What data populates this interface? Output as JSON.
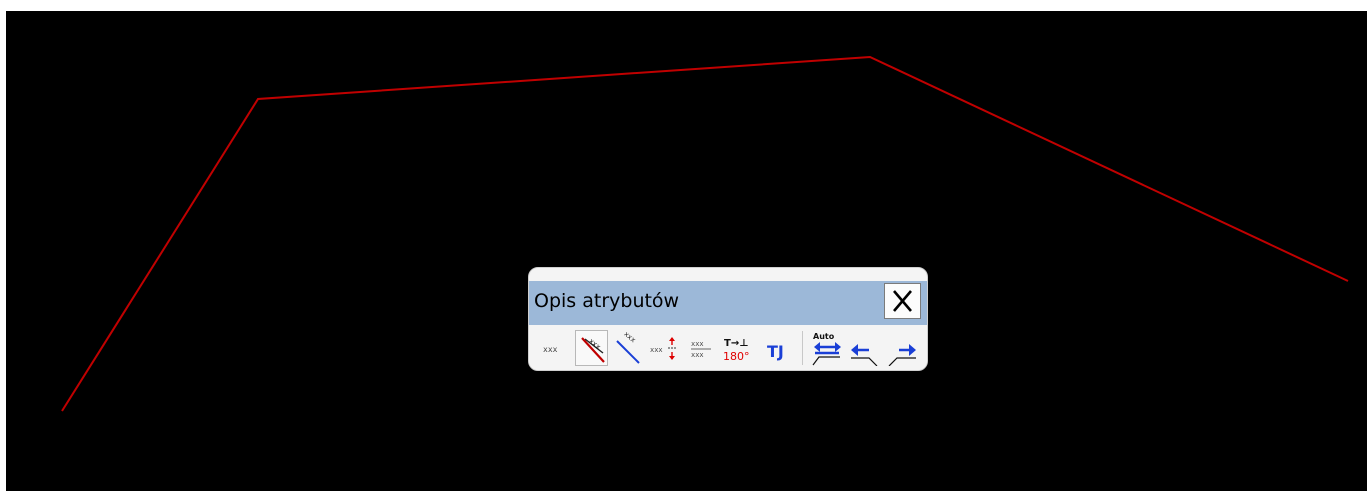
{
  "canvas": {
    "background": "#000000",
    "polyline_color": "#c00000"
  },
  "toolbar": {
    "title": "Opis atrybutów",
    "close_label": "X",
    "title_bar_color": "#9cb8d8",
    "tools": [
      {
        "name": "text-plain-tool",
        "icon": "xxx-text-icon",
        "pressed": false
      },
      {
        "name": "text-along-line-crossed-tool",
        "icon": "text-along-line-red-icon",
        "pressed": true
      },
      {
        "name": "text-along-line-tool",
        "icon": "text-along-line-blue-icon",
        "pressed": false
      },
      {
        "name": "text-offset-tool",
        "icon": "text-offset-red-arrows-icon",
        "pressed": false
      },
      {
        "name": "text-stacked-tool",
        "icon": "text-stacked-icon",
        "pressed": false
      },
      {
        "name": "text-rotate-180-tool",
        "icon": "rotate-180-icon",
        "pressed": false
      },
      {
        "name": "text-justify-tool",
        "icon": "tj-icon",
        "pressed": false
      },
      {
        "name": "auto-direction-tool",
        "icon": "auto-double-arrow-icon",
        "pressed": false
      },
      {
        "name": "direction-left-tool",
        "icon": "arrow-left-icon",
        "pressed": false
      },
      {
        "name": "direction-right-tool",
        "icon": "arrow-right-icon",
        "pressed": false
      }
    ],
    "icon_text": {
      "xxx": "xxx",
      "rotate_top": "T→⊥",
      "rotate_bottom": "180°",
      "tj": "TJ",
      "auto": "Auto"
    }
  }
}
